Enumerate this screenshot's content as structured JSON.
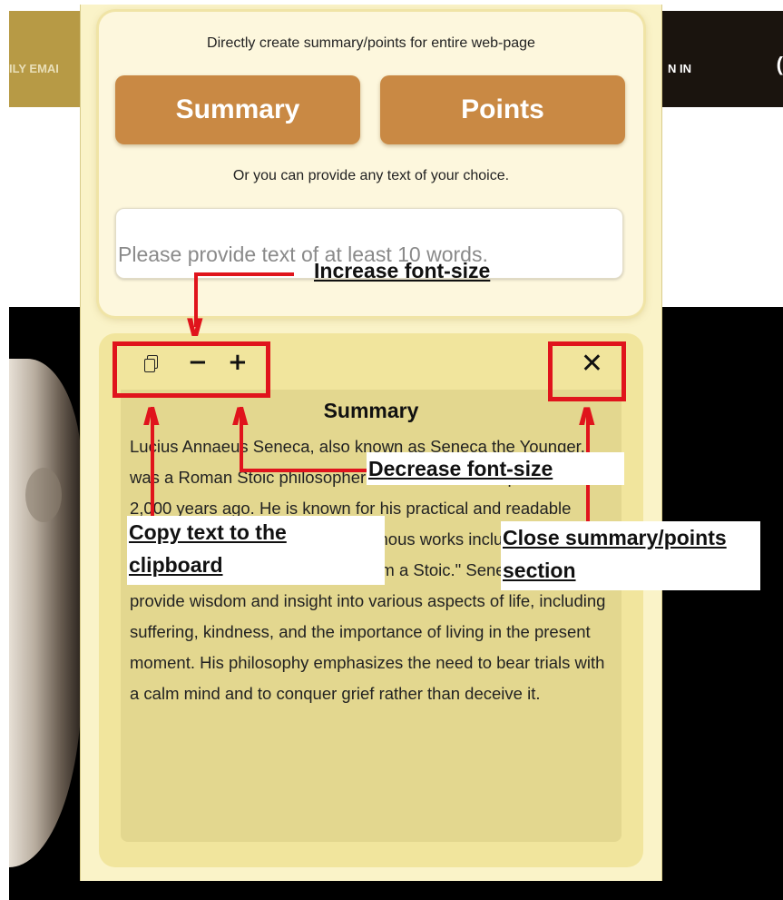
{
  "background": {
    "nav_left_text": "ILY EMAI",
    "nav_right_text": "N IN",
    "nav_right_glyph": "("
  },
  "panel": {
    "directive": "Directly create summary/points for entire web-page",
    "summary_button": "Summary",
    "points_button": "Points",
    "or_text": "Or you can provide any text of your choice.",
    "input_placeholder": "Please provide text of at least 10 words.",
    "input_value": ""
  },
  "toolbar": {
    "copy_icon": "copy-icon",
    "decrease_label": "−",
    "increase_label": "+",
    "close_label": "✕"
  },
  "summary": {
    "title": "Summary",
    "text": "Lucius Annaeus Seneca, also known as Seneca the Younger, was a Roman Stoic philosopher born in southern Spain over 2,000 years ago. He is known for his practical and readable writings, and some of his most famous works include \"On the Shortness of Life\" and \"Letters from a Stoic.\" Seneca's quotes provide wisdom and insight into various aspects of life, including suffering, kindness, and the importance of living in the present moment. His philosophy emphasizes the need to bear trials with a calm mind and to conquer grief rather than deceive it."
  },
  "annotations": {
    "increase": "Increase font-size",
    "decrease": "Decrease font-size",
    "copy_line1": "Copy text to the",
    "copy_line2": "clipboard",
    "close_line1": "Close summary/points",
    "close_line2": "section",
    "annotation_color": "#e0141c"
  }
}
